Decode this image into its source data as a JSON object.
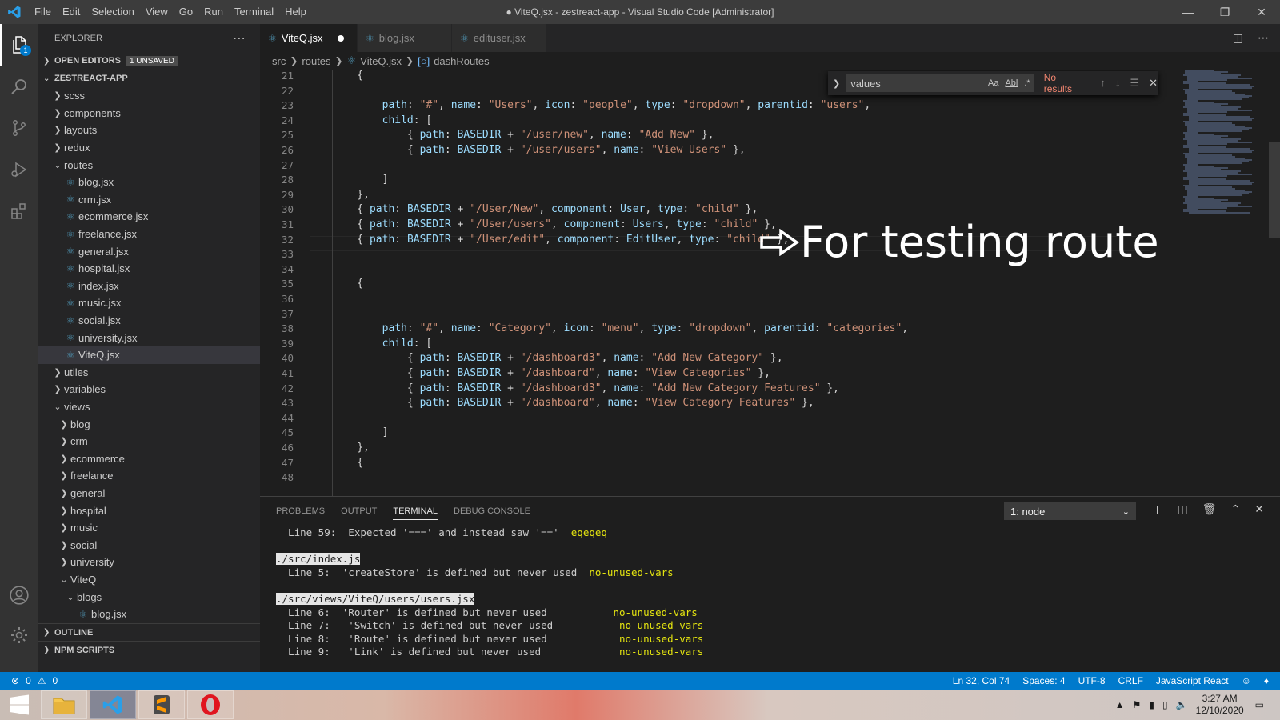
{
  "titlebar": {
    "menu": [
      "File",
      "Edit",
      "Selection",
      "View",
      "Go",
      "Run",
      "Terminal",
      "Help"
    ],
    "title": "● ViteQ.jsx - zestreact-app - Visual Studio Code [Administrator]"
  },
  "activity": {
    "explorer_badge": "1"
  },
  "sidebar": {
    "header": "EXPLORER",
    "open_editors": "OPEN EDITORS",
    "unsaved_badge": "1 UNSAVED",
    "project": "ZESTREACT-APP",
    "outline": "OUTLINE",
    "npm_scripts": "NPM SCRIPTS",
    "tree": [
      {
        "label": "scss",
        "type": "folder",
        "depth": 1,
        "open": false
      },
      {
        "label": "components",
        "type": "folder",
        "depth": 1,
        "open": false
      },
      {
        "label": "layouts",
        "type": "folder",
        "depth": 1,
        "open": false
      },
      {
        "label": "redux",
        "type": "folder",
        "depth": 1,
        "open": false
      },
      {
        "label": "routes",
        "type": "folder",
        "depth": 1,
        "open": true
      },
      {
        "label": "blog.jsx",
        "type": "file",
        "depth": 2
      },
      {
        "label": "crm.jsx",
        "type": "file",
        "depth": 2
      },
      {
        "label": "ecommerce.jsx",
        "type": "file",
        "depth": 2
      },
      {
        "label": "freelance.jsx",
        "type": "file",
        "depth": 2
      },
      {
        "label": "general.jsx",
        "type": "file",
        "depth": 2
      },
      {
        "label": "hospital.jsx",
        "type": "file",
        "depth": 2
      },
      {
        "label": "index.jsx",
        "type": "file",
        "depth": 2
      },
      {
        "label": "music.jsx",
        "type": "file",
        "depth": 2
      },
      {
        "label": "social.jsx",
        "type": "file",
        "depth": 2
      },
      {
        "label": "university.jsx",
        "type": "file",
        "depth": 2
      },
      {
        "label": "ViteQ.jsx",
        "type": "file",
        "depth": 2,
        "selected": true
      },
      {
        "label": "utiles",
        "type": "folder",
        "depth": 1,
        "open": false
      },
      {
        "label": "variables",
        "type": "folder",
        "depth": 1,
        "open": false
      },
      {
        "label": "views",
        "type": "folder",
        "depth": 1,
        "open": true
      },
      {
        "label": "blog",
        "type": "folder",
        "depth": 2,
        "open": false
      },
      {
        "label": "crm",
        "type": "folder",
        "depth": 2,
        "open": false
      },
      {
        "label": "ecommerce",
        "type": "folder",
        "depth": 2,
        "open": false
      },
      {
        "label": "freelance",
        "type": "folder",
        "depth": 2,
        "open": false
      },
      {
        "label": "general",
        "type": "folder",
        "depth": 2,
        "open": false
      },
      {
        "label": "hospital",
        "type": "folder",
        "depth": 2,
        "open": false
      },
      {
        "label": "music",
        "type": "folder",
        "depth": 2,
        "open": false
      },
      {
        "label": "social",
        "type": "folder",
        "depth": 2,
        "open": false
      },
      {
        "label": "university",
        "type": "folder",
        "depth": 2,
        "open": false
      },
      {
        "label": "ViteQ",
        "type": "folder",
        "depth": 2,
        "open": true
      },
      {
        "label": "blogs",
        "type": "folder",
        "depth": 3,
        "open": true
      },
      {
        "label": "blog.jsx",
        "type": "file",
        "depth": 4
      }
    ]
  },
  "tabs": [
    {
      "label": "ViteQ.jsx",
      "active": true,
      "dirty": true
    },
    {
      "label": "blog.jsx",
      "active": false
    },
    {
      "label": "edituser.jsx",
      "active": false
    }
  ],
  "breadcrumb": [
    "src",
    "routes",
    "ViteQ.jsx",
    "dashRoutes"
  ],
  "find": {
    "value": "values",
    "case": "Aa",
    "word": "Abl",
    "regex": ".*",
    "status": "No results"
  },
  "editor": {
    "lines": [
      {
        "n": "21",
        "t": [
          [
            "b",
            "    {"
          ]
        ]
      },
      {
        "n": "22",
        "t": []
      },
      {
        "n": "23",
        "t": [
          [
            "k",
            "        path"
          ],
          [
            "b",
            ": "
          ],
          [
            "s",
            "\"#\""
          ],
          [
            "b",
            ", "
          ],
          [
            "k",
            "name"
          ],
          [
            "b",
            ": "
          ],
          [
            "s",
            "\"Users\""
          ],
          [
            "b",
            ", "
          ],
          [
            "k",
            "icon"
          ],
          [
            "b",
            ": "
          ],
          [
            "s",
            "\"people\""
          ],
          [
            "b",
            ", "
          ],
          [
            "k",
            "type"
          ],
          [
            "b",
            ": "
          ],
          [
            "s",
            "\"dropdown\""
          ],
          [
            "b",
            ", "
          ],
          [
            "k",
            "parentid"
          ],
          [
            "b",
            ": "
          ],
          [
            "s",
            "\"users\""
          ],
          [
            "b",
            ","
          ]
        ]
      },
      {
        "n": "24",
        "t": [
          [
            "k",
            "        child"
          ],
          [
            "b",
            ": ["
          ]
        ]
      },
      {
        "n": "25",
        "t": [
          [
            "b",
            "            { "
          ],
          [
            "k",
            "path"
          ],
          [
            "b",
            ": "
          ],
          [
            "k",
            "BASEDIR"
          ],
          [
            "b",
            " + "
          ],
          [
            "s",
            "\"/user/new\""
          ],
          [
            "b",
            ", "
          ],
          [
            "k",
            "name"
          ],
          [
            "b",
            ": "
          ],
          [
            "s",
            "\"Add New\""
          ],
          [
            "b",
            " },"
          ]
        ]
      },
      {
        "n": "26",
        "t": [
          [
            "b",
            "            { "
          ],
          [
            "k",
            "path"
          ],
          [
            "b",
            ": "
          ],
          [
            "k",
            "BASEDIR"
          ],
          [
            "b",
            " + "
          ],
          [
            "s",
            "\"/user/users\""
          ],
          [
            "b",
            ", "
          ],
          [
            "k",
            "name"
          ],
          [
            "b",
            ": "
          ],
          [
            "s",
            "\"View Users\""
          ],
          [
            "b",
            " },"
          ]
        ]
      },
      {
        "n": "27",
        "t": []
      },
      {
        "n": "28",
        "t": [
          [
            "b",
            "        ]"
          ]
        ]
      },
      {
        "n": "29",
        "t": [
          [
            "b",
            "    },"
          ]
        ]
      },
      {
        "n": "30",
        "t": [
          [
            "b",
            "    { "
          ],
          [
            "k",
            "path"
          ],
          [
            "b",
            ": "
          ],
          [
            "k",
            "BASEDIR"
          ],
          [
            "b",
            " + "
          ],
          [
            "s",
            "\"/User/New\""
          ],
          [
            "b",
            ", "
          ],
          [
            "k",
            "component"
          ],
          [
            "b",
            ": "
          ],
          [
            "k",
            "User"
          ],
          [
            "b",
            ", "
          ],
          [
            "k",
            "type"
          ],
          [
            "b",
            ": "
          ],
          [
            "s",
            "\"child\""
          ],
          [
            "b",
            " },"
          ]
        ]
      },
      {
        "n": "31",
        "t": [
          [
            "b",
            "    { "
          ],
          [
            "k",
            "path"
          ],
          [
            "b",
            ": "
          ],
          [
            "k",
            "BASEDIR"
          ],
          [
            "b",
            " + "
          ],
          [
            "s",
            "\"/User/users\""
          ],
          [
            "b",
            ", "
          ],
          [
            "k",
            "component"
          ],
          [
            "b",
            ": "
          ],
          [
            "k",
            "Users"
          ],
          [
            "b",
            ", "
          ],
          [
            "k",
            "type"
          ],
          [
            "b",
            ": "
          ],
          [
            "s",
            "\"child\""
          ],
          [
            "b",
            " },"
          ]
        ]
      },
      {
        "n": "32",
        "t": [
          [
            "b",
            "    { "
          ],
          [
            "k",
            "path"
          ],
          [
            "b",
            ": "
          ],
          [
            "k",
            "BASEDIR"
          ],
          [
            "b",
            " + "
          ],
          [
            "s",
            "\"/User/edit\""
          ],
          [
            "b",
            ", "
          ],
          [
            "k",
            "component"
          ],
          [
            "b",
            ": "
          ],
          [
            "k",
            "EditUser"
          ],
          [
            "b",
            ", "
          ],
          [
            "k",
            "type"
          ],
          [
            "b",
            ": "
          ],
          [
            "s",
            "\"child\""
          ],
          [
            "b",
            " },"
          ]
        ]
      },
      {
        "n": "33",
        "t": []
      },
      {
        "n": "34",
        "t": []
      },
      {
        "n": "35",
        "t": [
          [
            "b",
            "    {"
          ]
        ]
      },
      {
        "n": "36",
        "t": []
      },
      {
        "n": "37",
        "t": []
      },
      {
        "n": "38",
        "t": [
          [
            "k",
            "        path"
          ],
          [
            "b",
            ": "
          ],
          [
            "s",
            "\"#\""
          ],
          [
            "b",
            ", "
          ],
          [
            "k",
            "name"
          ],
          [
            "b",
            ": "
          ],
          [
            "s",
            "\"Category\""
          ],
          [
            "b",
            ", "
          ],
          [
            "k",
            "icon"
          ],
          [
            "b",
            ": "
          ],
          [
            "s",
            "\"menu\""
          ],
          [
            "b",
            ", "
          ],
          [
            "k",
            "type"
          ],
          [
            "b",
            ": "
          ],
          [
            "s",
            "\"dropdown\""
          ],
          [
            "b",
            ", "
          ],
          [
            "k",
            "parentid"
          ],
          [
            "b",
            ": "
          ],
          [
            "s",
            "\"categories\""
          ],
          [
            "b",
            ","
          ]
        ]
      },
      {
        "n": "39",
        "t": [
          [
            "k",
            "        child"
          ],
          [
            "b",
            ": ["
          ]
        ]
      },
      {
        "n": "40",
        "t": [
          [
            "b",
            "            { "
          ],
          [
            "k",
            "path"
          ],
          [
            "b",
            ": "
          ],
          [
            "k",
            "BASEDIR"
          ],
          [
            "b",
            " + "
          ],
          [
            "s",
            "\"/dashboard3\""
          ],
          [
            "b",
            ", "
          ],
          [
            "k",
            "name"
          ],
          [
            "b",
            ": "
          ],
          [
            "s",
            "\"Add New Category\""
          ],
          [
            "b",
            " },"
          ]
        ]
      },
      {
        "n": "41",
        "t": [
          [
            "b",
            "            { "
          ],
          [
            "k",
            "path"
          ],
          [
            "b",
            ": "
          ],
          [
            "k",
            "BASEDIR"
          ],
          [
            "b",
            " + "
          ],
          [
            "s",
            "\"/dashboard\""
          ],
          [
            "b",
            ", "
          ],
          [
            "k",
            "name"
          ],
          [
            "b",
            ": "
          ],
          [
            "s",
            "\"View Categories\""
          ],
          [
            "b",
            " },"
          ]
        ]
      },
      {
        "n": "42",
        "t": [
          [
            "b",
            "            { "
          ],
          [
            "k",
            "path"
          ],
          [
            "b",
            ": "
          ],
          [
            "k",
            "BASEDIR"
          ],
          [
            "b",
            " + "
          ],
          [
            "s",
            "\"/dashboard3\""
          ],
          [
            "b",
            ", "
          ],
          [
            "k",
            "name"
          ],
          [
            "b",
            ": "
          ],
          [
            "s",
            "\"Add New Category Features\""
          ],
          [
            "b",
            " },"
          ]
        ]
      },
      {
        "n": "43",
        "t": [
          [
            "b",
            "            { "
          ],
          [
            "k",
            "path"
          ],
          [
            "b",
            ": "
          ],
          [
            "k",
            "BASEDIR"
          ],
          [
            "b",
            " + "
          ],
          [
            "s",
            "\"/dashboard\""
          ],
          [
            "b",
            ", "
          ],
          [
            "k",
            "name"
          ],
          [
            "b",
            ": "
          ],
          [
            "s",
            "\"View Category Features\""
          ],
          [
            "b",
            " },"
          ]
        ]
      },
      {
        "n": "44",
        "t": []
      },
      {
        "n": "45",
        "t": [
          [
            "b",
            "        ]"
          ]
        ]
      },
      {
        "n": "46",
        "t": [
          [
            "b",
            "    },"
          ]
        ]
      },
      {
        "n": "47",
        "t": [
          [
            "b",
            "    {"
          ]
        ]
      },
      {
        "n": "48",
        "t": []
      }
    ],
    "annotation": "For testing route"
  },
  "panel": {
    "tabs": [
      "PROBLEMS",
      "OUTPUT",
      "TERMINAL",
      "DEBUG CONSOLE"
    ],
    "active_tab": "TERMINAL",
    "terminal_select": "1: node",
    "terminal_lines": [
      {
        "parts": [
          [
            "n",
            "  Line 59:  Expected '===' and instead saw '=='  "
          ],
          [
            "y",
            "eqeqeq"
          ]
        ]
      },
      {
        "parts": []
      },
      {
        "parts": [
          [
            "i",
            "./src/index.js"
          ]
        ]
      },
      {
        "parts": [
          [
            "n",
            "  Line 5:  'createStore' is defined but never used  "
          ],
          [
            "y",
            "no-unused-vars"
          ]
        ]
      },
      {
        "parts": []
      },
      {
        "parts": [
          [
            "i",
            "./src/views/ViteQ/users/users.jsx"
          ]
        ]
      },
      {
        "parts": [
          [
            "n",
            "  Line 6:  'Router' is defined but never used           "
          ],
          [
            "y",
            "no-unused-vars"
          ]
        ]
      },
      {
        "parts": [
          [
            "n",
            "  Line 7:   'Switch' is defined but never used           "
          ],
          [
            "y",
            "no-unused-vars"
          ]
        ]
      },
      {
        "parts": [
          [
            "n",
            "  Line 8:   'Route' is defined but never used            "
          ],
          [
            "y",
            "no-unused-vars"
          ]
        ]
      },
      {
        "parts": [
          [
            "n",
            "  Line 9:   'Link' is defined but never used             "
          ],
          [
            "y",
            "no-unused-vars"
          ]
        ]
      }
    ]
  },
  "status": {
    "errors": "0",
    "warnings": "0",
    "position": "Ln 32, Col 74",
    "spaces": "Spaces: 4",
    "encoding": "UTF-8",
    "eol": "CRLF",
    "language": "JavaScript React"
  },
  "taskbar": {
    "time": "3:27 AM",
    "date": "12/10/2020"
  }
}
